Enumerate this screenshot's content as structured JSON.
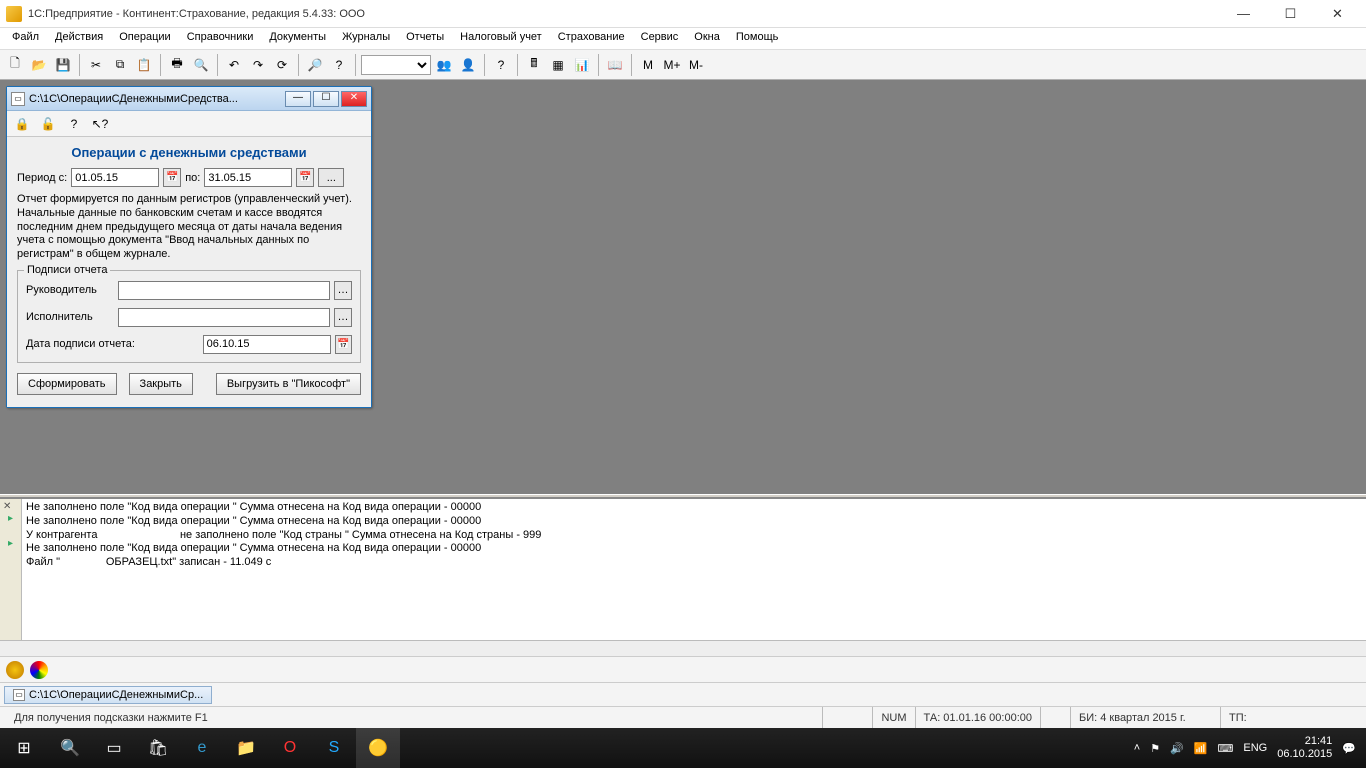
{
  "titlebar": {
    "text": "1С:Предприятие - Континент:Страхование, редакция 5.4.33: ООО"
  },
  "menu": [
    "Файл",
    "Действия",
    "Операции",
    "Справочники",
    "Документы",
    "Журналы",
    "Отчеты",
    "Налоговый учет",
    "Страхование",
    "Сервис",
    "Окна",
    "Помощь"
  ],
  "toolbar_letters": [
    "М",
    "М+",
    "М-"
  ],
  "child": {
    "title": "С:\\1С\\ОперацииСДенежнымиСредства...",
    "heading": "Операции с денежными средствами",
    "period_label_from": "Период с:",
    "period_from": "01.05.15",
    "period_label_to": "по:",
    "period_to": "31.05.15",
    "dots": "...",
    "description": "Отчет формируется по данным регистров (управленческий учет). Начальные данные по банковским счетам и кассе вводятся последним днем предыдущего месяца от даты начала ведения учета с помощью документа \"Ввод начальных данных по регистрам\" в общем журнале.",
    "fieldset_legend": "Подписи отчета",
    "leader_label": "Руководитель",
    "leader_value": "",
    "executor_label": "Исполнитель",
    "executor_value": "",
    "sign_date_label": "Дата подписи отчета:",
    "sign_date": "06.10.15",
    "btn_form": "Сформировать",
    "btn_close": "Закрыть",
    "btn_export": "Выгрузить в \"Пикософт\""
  },
  "log": [
    "Не заполнено поле \"Код вида операции \" Сумма отнесена на Код вида операции - 00000",
    "Не заполнено поле \"Код вида операции \" Сумма отнесена на Код вида операции - 00000",
    "У контрагента                           не заполнено поле \"Код страны \" Сумма отнесена на Код страны - 999",
    "Не заполнено поле \"Код вида операции \" Сумма отнесена на Код вида операции - 00000",
    "Файл \"               ОБРАЗЕЦ.txt\" записан - 11.049 с"
  ],
  "task_item": "С:\\1С\\ОперацииСДенежнымиСр...",
  "status": {
    "hint": "Для получения подсказки нажмите F1",
    "num": "NUM",
    "ta": "ТА: 01.01.16  00:00:00",
    "bi": "БИ: 4 квартал 2015 г.",
    "tp": "ТП:"
  },
  "tray": {
    "lang_code": "ENG",
    "time": "21:41",
    "date": "06.10.2015"
  }
}
